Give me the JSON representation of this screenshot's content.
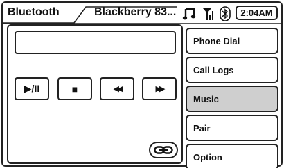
{
  "header": {
    "tab_label": "Bluetooth",
    "device_name": "Blackberry 83...",
    "time": "2:04AM",
    "icons": [
      "music-note-icon",
      "signal-icon",
      "bluetooth-icon"
    ]
  },
  "player": {
    "track_text": "",
    "controls": [
      {
        "name": "play-pause",
        "label": "▶/II"
      },
      {
        "name": "stop",
        "label": "■"
      },
      {
        "name": "previous",
        "label": "◀◀"
      },
      {
        "name": "next",
        "label": "▶▶"
      }
    ],
    "link_icon": "link-icon"
  },
  "menu": {
    "items": [
      {
        "label": "Phone Dial",
        "selected": false
      },
      {
        "label": "Call Logs",
        "selected": false
      },
      {
        "label": "Music",
        "selected": true
      },
      {
        "label": "Pair",
        "selected": false
      },
      {
        "label": "Option",
        "selected": false
      }
    ]
  },
  "colors": {
    "selected_bg": "#cfcfcf",
    "stroke": "#222222"
  }
}
